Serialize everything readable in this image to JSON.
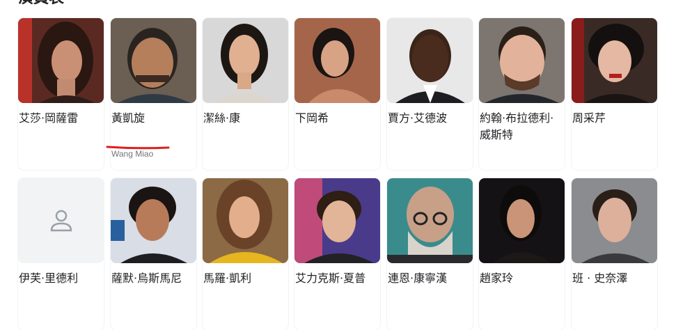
{
  "section": {
    "title": "演員表"
  },
  "cast": [
    {
      "name": "艾莎·岡薩雷",
      "role": ""
    },
    {
      "name": "黃凱旋",
      "role": "Wang Miao"
    },
    {
      "name": "潔絲·康",
      "role": ""
    },
    {
      "name": "下岡希",
      "role": ""
    },
    {
      "name": "賈方·艾德波",
      "role": ""
    },
    {
      "name": "約翰·布拉德利·威斯特",
      "role": ""
    },
    {
      "name": "周采芹",
      "role": ""
    },
    {
      "name": "伊芙·里德利",
      "role": ""
    },
    {
      "name": "薩默·烏斯馬尼",
      "role": ""
    },
    {
      "name": "馬羅·凱利",
      "role": ""
    },
    {
      "name": "艾力克斯·夏普",
      "role": ""
    },
    {
      "name": "連恩·康寧漢",
      "role": ""
    },
    {
      "name": "趙家玲",
      "role": ""
    },
    {
      "name": "班 · 史奈澤",
      "role": ""
    }
  ],
  "colors": {
    "annotation": "#e01e1e",
    "role_text": "#70757a"
  }
}
